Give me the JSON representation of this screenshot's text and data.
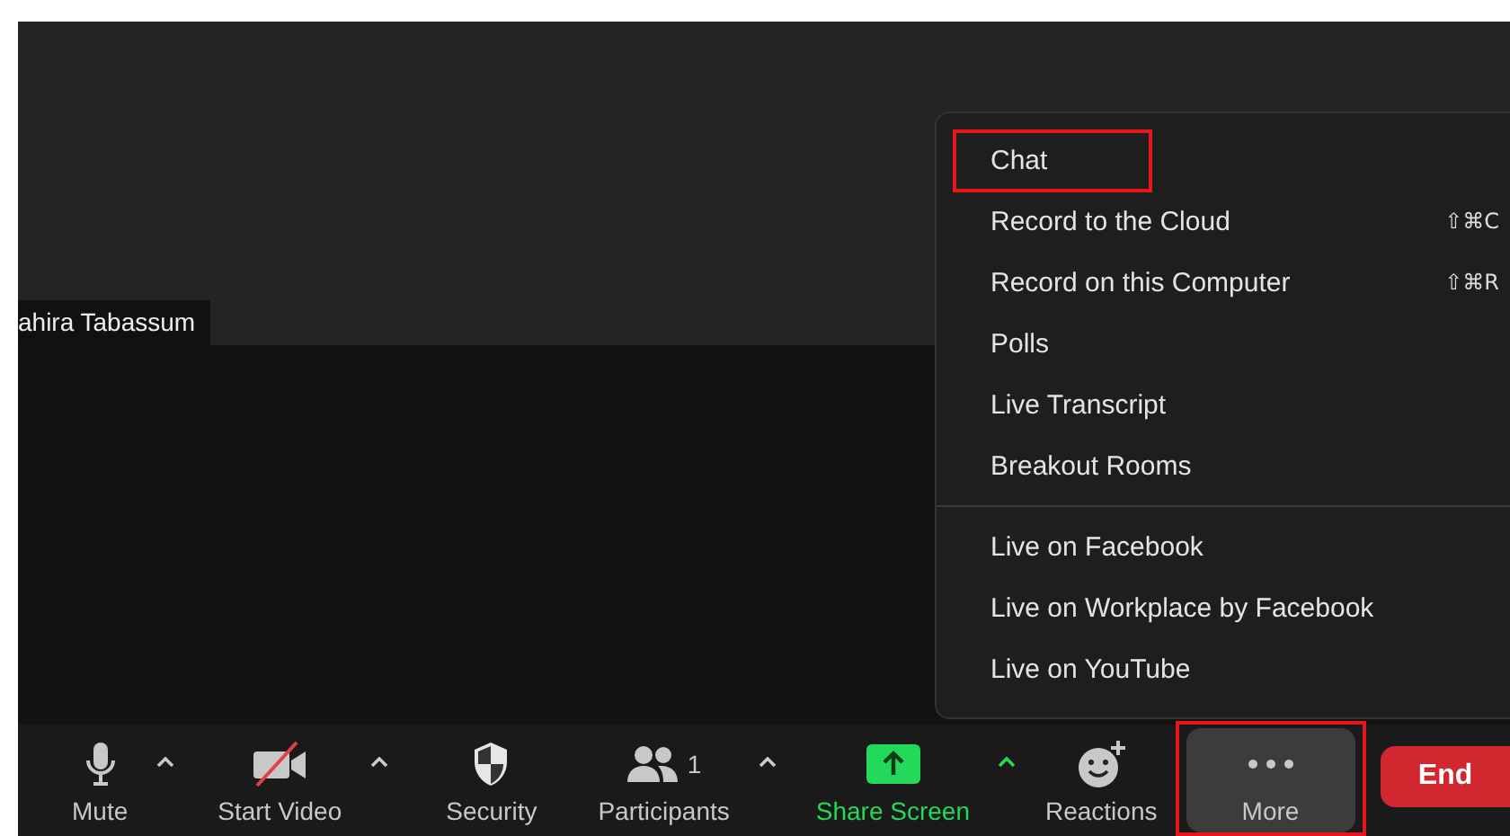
{
  "participant_name": "ahira Tabassum",
  "menu": {
    "sections": [
      [
        {
          "label": "Chat",
          "highlighted": true
        },
        {
          "label": "Record to the Cloud",
          "shortcut": "⇧⌘C",
          "highlighted": false
        },
        {
          "label": "Record on this Computer",
          "shortcut": "⇧⌘R",
          "highlighted": false
        },
        {
          "label": "Polls",
          "highlighted": false
        },
        {
          "label": "Live Transcript",
          "highlighted": false
        },
        {
          "label": "Breakout Rooms",
          "highlighted": false
        }
      ],
      [
        {
          "label": "Live on Facebook",
          "highlighted": false
        },
        {
          "label": "Live on Workplace by Facebook",
          "highlighted": false
        },
        {
          "label": "Live on YouTube",
          "highlighted": false
        }
      ]
    ]
  },
  "toolbar": [
    {
      "kind": "mute",
      "label": "Mute",
      "caret": true,
      "highlighted": false
    },
    {
      "kind": "video",
      "label": "Start Video",
      "caret": true,
      "off": true,
      "highlighted": false
    },
    {
      "kind": "security",
      "label": "Security",
      "caret": false,
      "highlighted": false
    },
    {
      "kind": "participants",
      "label": "Participants",
      "count": "1",
      "caret": true,
      "highlighted": false
    },
    {
      "kind": "share",
      "label": "Share Screen",
      "caret": true,
      "highlighted": false
    },
    {
      "kind": "reactions",
      "label": "Reactions",
      "caret": false,
      "highlighted": false
    },
    {
      "kind": "more",
      "label": "More",
      "caret": false,
      "highlighted": true
    },
    {
      "kind": "end",
      "label": "End"
    }
  ]
}
